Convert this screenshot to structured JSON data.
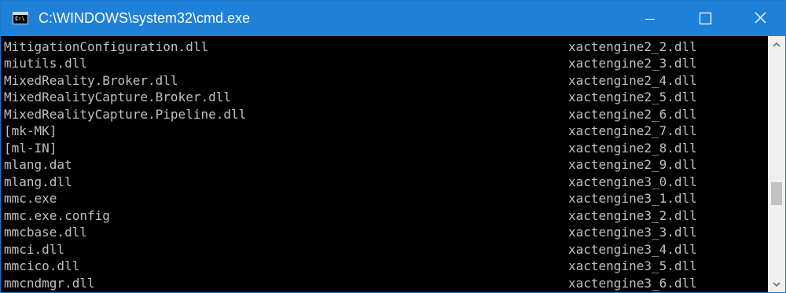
{
  "window": {
    "title": "C:\\WINDOWS\\system32\\cmd.exe",
    "icon": "cmd-prompt-icon",
    "icon_text": "C:\\",
    "controls": [
      "minimize-icon",
      "maximize-icon",
      "close-icon"
    ]
  },
  "colors": {
    "titlebar": "#1f80d8",
    "console_bg": "#000000",
    "console_text": "#c0c0c0",
    "scrollbar_track": "#f0f0f0"
  },
  "console": {
    "rows": [
      {
        "left": "MitigationConfiguration.dll",
        "right": "xactengine2_2.dll"
      },
      {
        "left": "miutils.dll",
        "right": "xactengine2_3.dll"
      },
      {
        "left": "MixedReality.Broker.dll",
        "right": "xactengine2_4.dll"
      },
      {
        "left": "MixedRealityCapture.Broker.dll",
        "right": "xactengine2_5.dll"
      },
      {
        "left": "MixedRealityCapture.Pipeline.dll",
        "right": "xactengine2_6.dll"
      },
      {
        "left": "[mk-MK]",
        "right": "xactengine2_7.dll"
      },
      {
        "left": "[ml-IN]",
        "right": "xactengine2_8.dll"
      },
      {
        "left": "mlang.dat",
        "right": "xactengine2_9.dll"
      },
      {
        "left": "mlang.dll",
        "right": "xactengine3_0.dll"
      },
      {
        "left": "mmc.exe",
        "right": "xactengine3_1.dll"
      },
      {
        "left": "mmc.exe.config",
        "right": "xactengine3_2.dll"
      },
      {
        "left": "mmcbase.dll",
        "right": "xactengine3_3.dll"
      },
      {
        "left": "mmci.dll",
        "right": "xactengine3_4.dll"
      },
      {
        "left": "mmcico.dll",
        "right": "xactengine3_5.dll"
      },
      {
        "left": "mmcndmgr.dll",
        "right": "xactengine3_6.dll"
      }
    ]
  }
}
